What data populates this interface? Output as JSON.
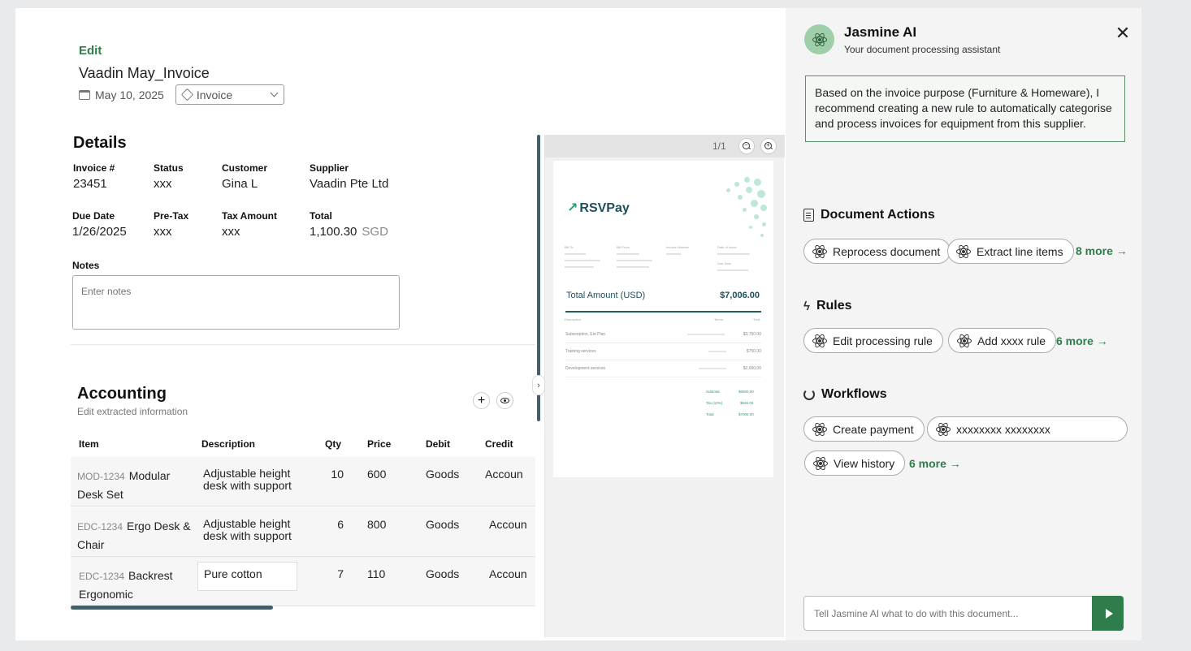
{
  "header": {
    "edit_label": "Edit",
    "title": "Vaadin  May_Invoice",
    "date": "May 10, 2025",
    "doc_type": "Invoice"
  },
  "details": {
    "title": "Details",
    "fields": {
      "invoice_no": {
        "label": "Invoice #",
        "value": "23451"
      },
      "status": {
        "label": "Status",
        "value": "xxx"
      },
      "customer": {
        "label": "Customer",
        "value": "Gina L"
      },
      "supplier": {
        "label": "Supplier",
        "value": "Vaadin Pte Ltd"
      },
      "due_date": {
        "label": "Due Date",
        "value": "1/26/2025"
      },
      "pre_tax": {
        "label": "Pre-Tax",
        "value": "xxx"
      },
      "tax_amount": {
        "label": "Tax Amount",
        "value": "xxx"
      },
      "total": {
        "label": "Total",
        "value": "1,100.30",
        "currency": "SGD"
      }
    },
    "notes_label": "Notes",
    "notes_placeholder": "Enter notes"
  },
  "accounting": {
    "title": "Accounting",
    "subtitle": "Edit extracted information",
    "add_icon": "plus-icon",
    "view_icon": "eye-icon",
    "columns": [
      "Item",
      "Description",
      "Qty",
      "Price",
      "Debit",
      "Credit"
    ],
    "rows": [
      {
        "code": "MOD-1234",
        "item": "Modular Desk Set",
        "description": "Adjustable height desk with support",
        "qty": "10",
        "price": "600",
        "debit": "Goods",
        "credit": "Accoun"
      },
      {
        "code": "EDC-1234",
        "item": "Ergo Desk & Chair",
        "description": "Adjustable height desk with support",
        "qty": "6",
        "price": "800",
        "debit": "Goods",
        "credit": "Accoun"
      },
      {
        "code": "EDC-1234",
        "item": "Backrest Ergonomic",
        "description": "Pure cotton",
        "qty": "7",
        "price": "110",
        "debit": "Goods",
        "credit": "Accoun"
      }
    ]
  },
  "preview": {
    "page_indicator": "1/1",
    "logo": "RSVPay",
    "labels": [
      "Bill To",
      "Bill From",
      "Invoice Number",
      "Date of Issue",
      "Due Date"
    ],
    "total_label": "Total Amount (USD)",
    "total_amount": "$7,006.00",
    "col_labels": [
      "Description",
      "Terms",
      "Total"
    ],
    "lines": [
      {
        "desc": "Subscription, Ent Plan",
        "amount": "$3,750.00"
      },
      {
        "desc": "Training services",
        "amount": "$750.00"
      },
      {
        "desc": "Development services",
        "amount": "$2,000.00"
      }
    ],
    "summary": [
      {
        "label": "Subtotal",
        "amount": "$6500.00"
      },
      {
        "label": "Tax (10%)",
        "amount": "$526.00"
      },
      {
        "label": "Total",
        "amount": "$7006.00"
      }
    ]
  },
  "assistant": {
    "name": "Jasmine AI",
    "subtitle": "Your document processing assistant",
    "recommendation": "Based on the invoice purpose (Furniture & Homeware), I recommend creating a new rule to automatically categorise and process invoices for equipment from this supplier.",
    "sections": {
      "document_actions": {
        "title": "Document Actions",
        "actions": [
          "Reprocess document",
          "Extract line items"
        ],
        "more": "8 more →"
      },
      "rules": {
        "title": "Rules",
        "actions": [
          "Edit processing rule",
          "Add xxxx rule"
        ],
        "more": "6 more →"
      },
      "workflows": {
        "title": "Workflows",
        "actions": [
          "Create payment",
          "xxxxxxxx xxxxxxxx",
          "View history"
        ],
        "more": "6 more →"
      }
    },
    "input_placeholder": "Tell Jasmine AI what to do with this document..."
  },
  "colors": {
    "accent": "#2e7d4a",
    "scrollbar": "#43606a",
    "avatar": "#9fcfa9"
  }
}
